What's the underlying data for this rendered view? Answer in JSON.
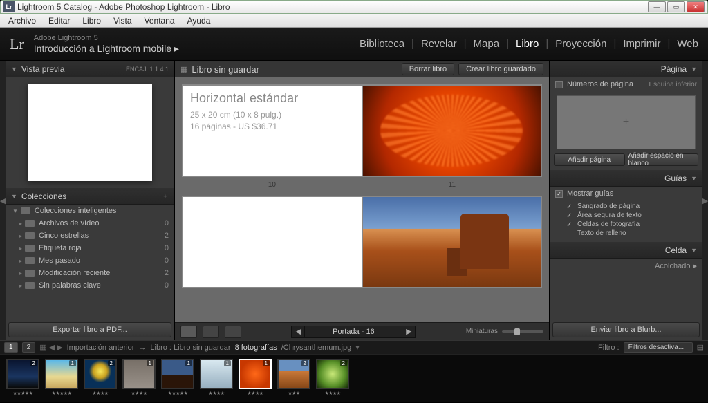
{
  "titlebar": {
    "title": "Lightroom 5 Catalog - Adobe Photoshop Lightroom - Libro"
  },
  "menubar": [
    "Archivo",
    "Editar",
    "Libro",
    "Vista",
    "Ventana",
    "Ayuda"
  ],
  "header": {
    "logo": "Lr",
    "product": "Adobe Lightroom 5",
    "tagline": "Introducción a Lightroom mobile ▸",
    "modules": [
      "Biblioteca",
      "Revelar",
      "Mapa",
      "Libro",
      "Proyección",
      "Imprimir",
      "Web"
    ],
    "active_module": "Libro"
  },
  "left": {
    "preview_title": "Vista previa",
    "preview_meta": "ENCAJ.   1:1   4:1",
    "collections_title": "Colecciones",
    "smart_header": "Colecciones inteligentes",
    "items": [
      {
        "label": "Archivos de vídeo",
        "count": "0"
      },
      {
        "label": "Cinco estrellas",
        "count": "2"
      },
      {
        "label": "Etiqueta roja",
        "count": "0"
      },
      {
        "label": "Mes pasado",
        "count": "0"
      },
      {
        "label": "Modificación reciente",
        "count": "2"
      },
      {
        "label": "Sin palabras clave",
        "count": "0"
      }
    ],
    "export_btn": "Exportar libro a PDF..."
  },
  "center": {
    "title": "Libro sin guardar",
    "clear_btn": "Borrar libro",
    "save_btn": "Crear libro guardado",
    "layout_title": "Horizontal estándar",
    "layout_size": "25 x 20 cm (10 x 8 pulg.)",
    "layout_pages": "16 páginas - US $36.71",
    "page_left": "10",
    "page_right": "11",
    "pager_label": "Portada - 16",
    "thumb_label": "Miniaturas"
  },
  "right": {
    "page_title": "Página",
    "pagenum_label": "Números de página",
    "pagenum_pos": "Esquina inferior",
    "add_page": "Añadir página",
    "add_blank": "Añadir espacio en blanco",
    "guides_title": "Guías",
    "show_guides": "Mostrar guías",
    "guide_items": [
      {
        "label": "Sangrado de página",
        "on": true
      },
      {
        "label": "Área segura de texto",
        "on": true
      },
      {
        "label": "Celdas de fotografía",
        "on": true
      },
      {
        "label": "Texto de relleno",
        "on": false
      }
    ],
    "cell_title": "Celda",
    "padding": "Acolchado",
    "send_btn": "Enviar libro a Blurb..."
  },
  "secbar": {
    "pages": [
      "1",
      "2"
    ],
    "crumb1": "Importación anterior",
    "crumb2": "Libro : Libro sin guardar",
    "count": "8 fotografías",
    "filename": "/Chrysanthemum.jpg",
    "filter_label": "Filtro :",
    "filter_value": "Filtros desactiva..."
  },
  "thumbs": [
    {
      "cls": "th-night",
      "badge": "2",
      "stars": "★★★★★"
    },
    {
      "cls": "th-beach",
      "badge": "1",
      "stars": "★★★★★"
    },
    {
      "cls": "th-jelly",
      "badge": "2",
      "stars": "★★★★"
    },
    {
      "cls": "th-koala",
      "badge": "1",
      "stars": "★★★★"
    },
    {
      "cls": "th-cliff",
      "badge": "1",
      "stars": "★★★★★"
    },
    {
      "cls": "th-peng",
      "badge": "1",
      "stars": "★★★★"
    },
    {
      "cls": "th-flower",
      "badge": "1",
      "stars": "★★★★",
      "sel": true
    },
    {
      "cls": "th-desert",
      "badge": "2",
      "stars": "★★★"
    },
    {
      "cls": "th-green",
      "badge": "2",
      "stars": "★★★★"
    }
  ]
}
